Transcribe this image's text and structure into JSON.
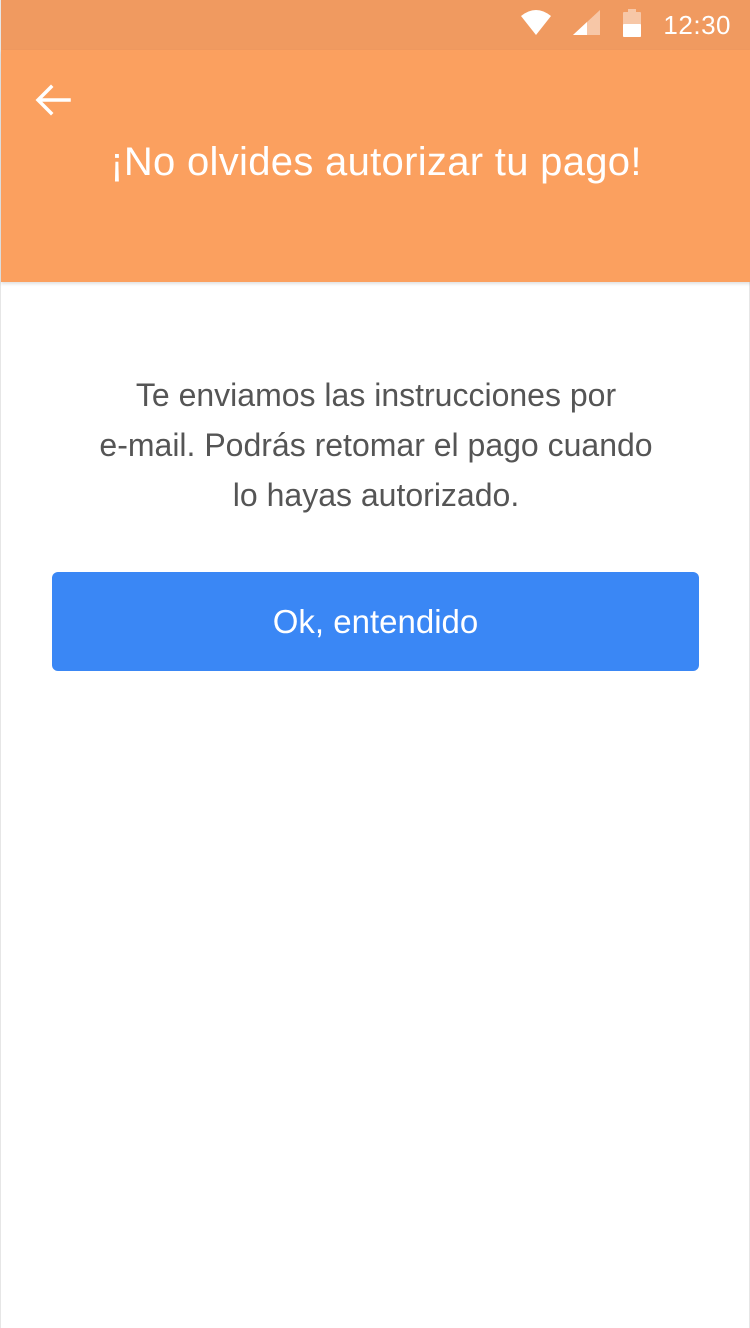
{
  "status_bar": {
    "time": "12:30",
    "icons": [
      "wifi-icon",
      "signal-icon",
      "battery-icon"
    ]
  },
  "app_bar": {
    "back_icon": "arrow-left-icon",
    "title": "¡No olvides autorizar tu pago!"
  },
  "main": {
    "message_lines": [
      "Te enviamos las instrucciones por",
      "e-mail. Podrás retomar el pago cuando",
      "lo hayas autorizado."
    ],
    "button_label": "Ok, entendido"
  },
  "colors": {
    "status_bar": "#f09a60",
    "app_bar": "#fba05f",
    "button": "#3a87f5",
    "message_text": "#555555"
  }
}
